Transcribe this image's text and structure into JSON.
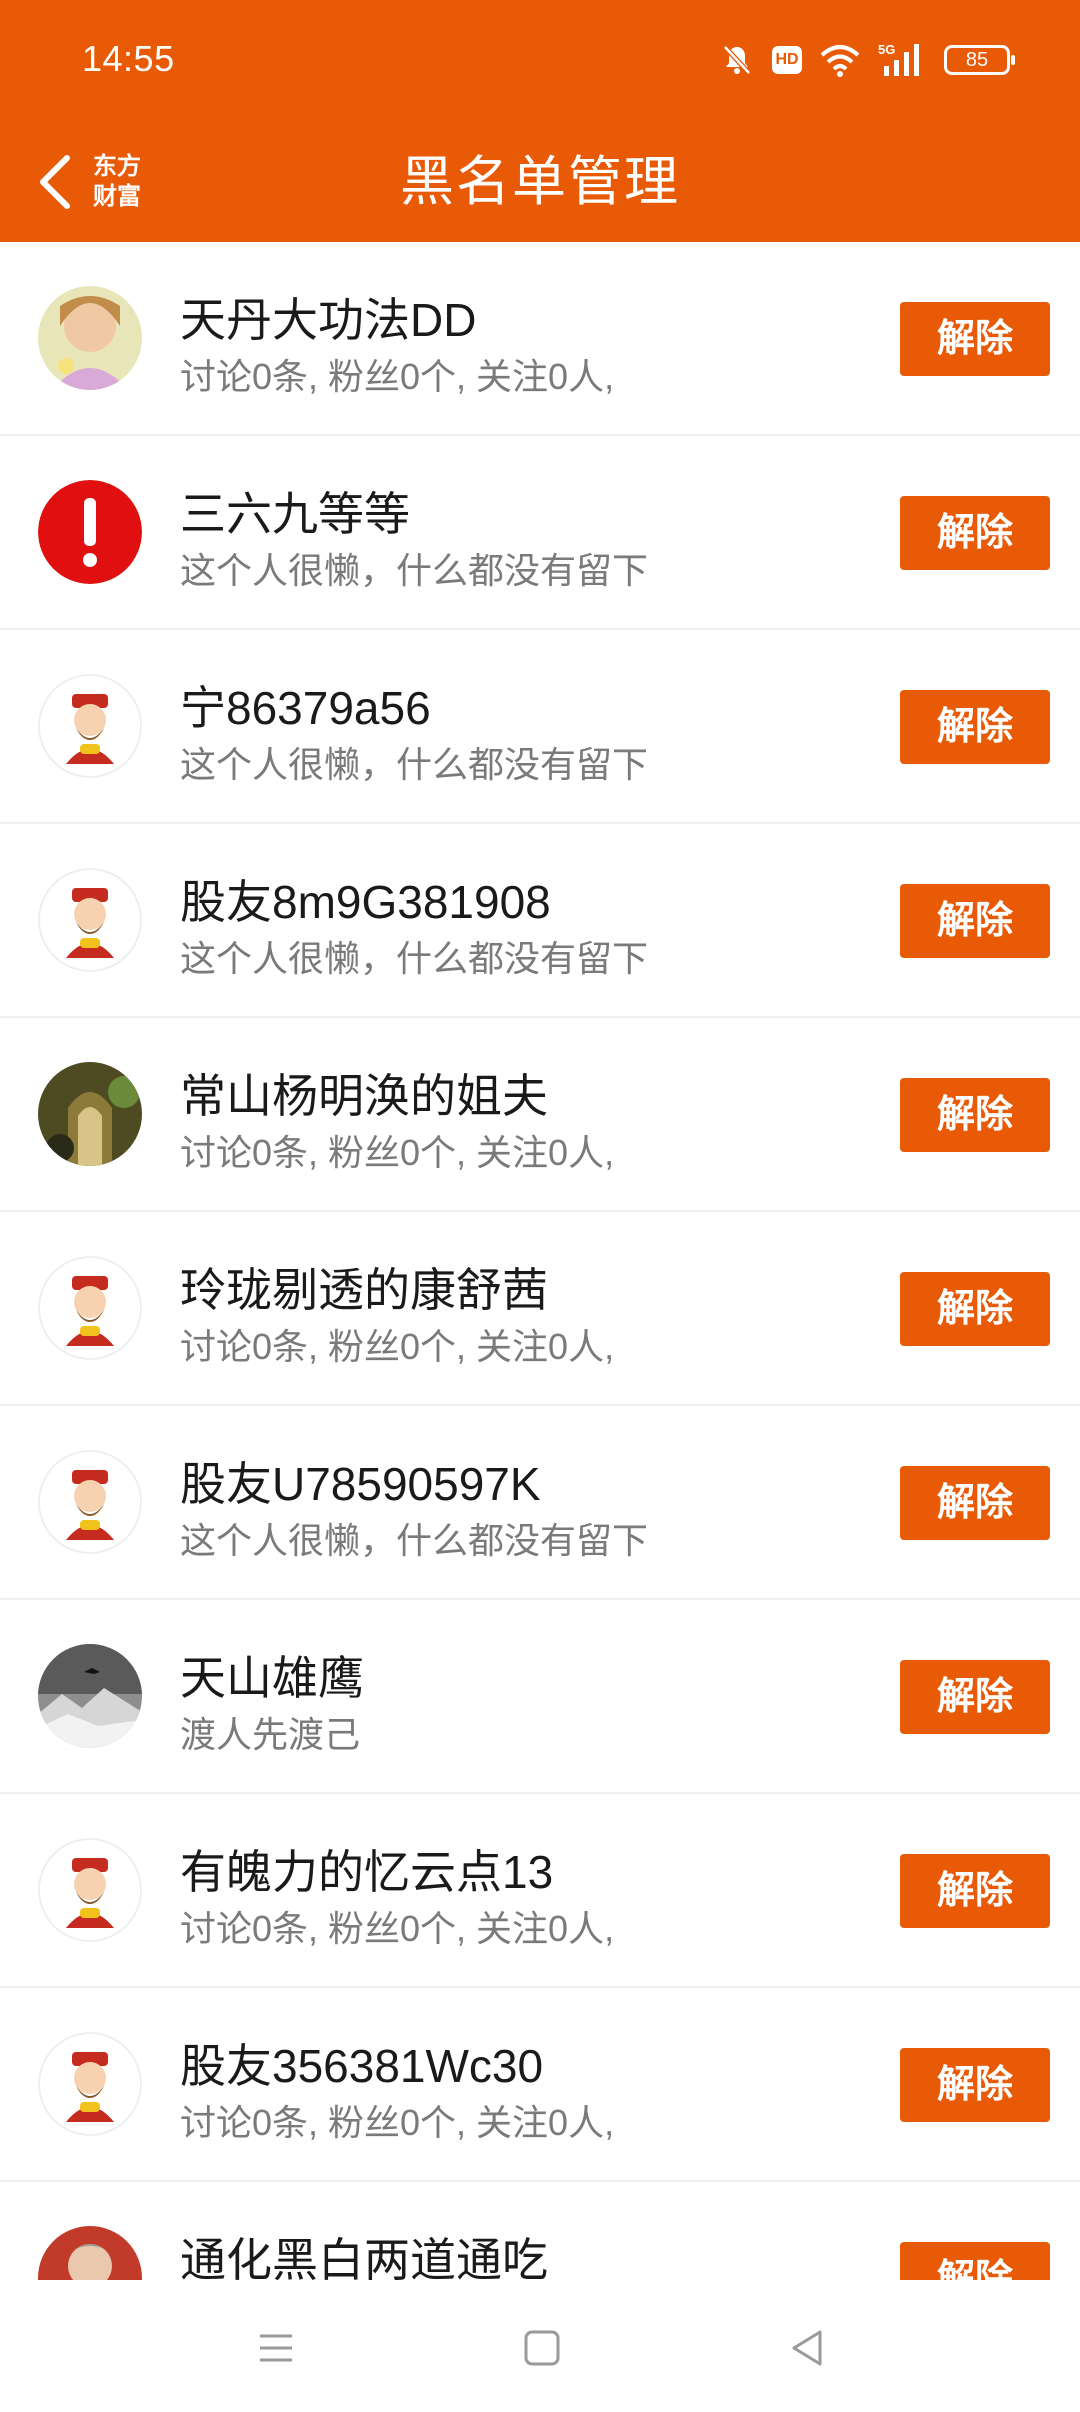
{
  "status_bar": {
    "time": "14:55",
    "icons": [
      "bell-muted-icon",
      "hd-icon",
      "wifi-icon",
      "5g-signal-icon",
      "battery-icon"
    ],
    "hd_label": "HD",
    "network_label": "5G",
    "battery": "85"
  },
  "header": {
    "title": "黑名单管理",
    "logo_lines": [
      "东方",
      "财富"
    ],
    "back_icon": "chevron-left-icon"
  },
  "colors": {
    "accent": "#e95a07",
    "text": "#1a1a1a",
    "subtext": "#7a7a7a",
    "divider": "#eeeeee"
  },
  "button_label": "解除",
  "users": [
    {
      "name": "天丹大功法DD",
      "desc": "讨论0条, 粉丝0个, 关注0人,",
      "avatar": "photo-avatar-icon"
    },
    {
      "name": "三六九等等",
      "desc": "这个人很懒，什么都没有留下",
      "avatar": "warning-avatar-icon"
    },
    {
      "name": "宁86379a56",
      "desc": "这个人很懒，什么都没有留下",
      "avatar": "fortune-god-avatar-icon"
    },
    {
      "name": "股友8m9G381908",
      "desc": "这个人很懒，什么都没有留下",
      "avatar": "fortune-god-avatar-icon"
    },
    {
      "name": "常山杨明涣的姐夫",
      "desc": "讨论0条, 粉丝0个, 关注0人,",
      "avatar": "photo-avatar-icon"
    },
    {
      "name": "玲珑剔透的康舒茜",
      "desc": "讨论0条, 粉丝0个, 关注0人,",
      "avatar": "fortune-god-avatar-icon"
    },
    {
      "name": "股友U78590597K",
      "desc": "这个人很懒，什么都没有留下",
      "avatar": "fortune-god-avatar-icon"
    },
    {
      "name": "天山雄鹰",
      "desc": "渡人先渡己",
      "avatar": "photo-avatar-icon"
    },
    {
      "name": "有魄力的忆云点13",
      "desc": "讨论0条, 粉丝0个, 关注0人,",
      "avatar": "fortune-god-avatar-icon"
    },
    {
      "name": "股友356381Wc30",
      "desc": "讨论0条, 粉丝0个, 关注0人,",
      "avatar": "fortune-god-avatar-icon"
    },
    {
      "name": "通化黑白两道通吃",
      "desc": "",
      "avatar": "photo-avatar-icon"
    }
  ],
  "nav_bar": {
    "icons": [
      "menu-icon",
      "home-icon",
      "back-triangle-icon"
    ]
  }
}
